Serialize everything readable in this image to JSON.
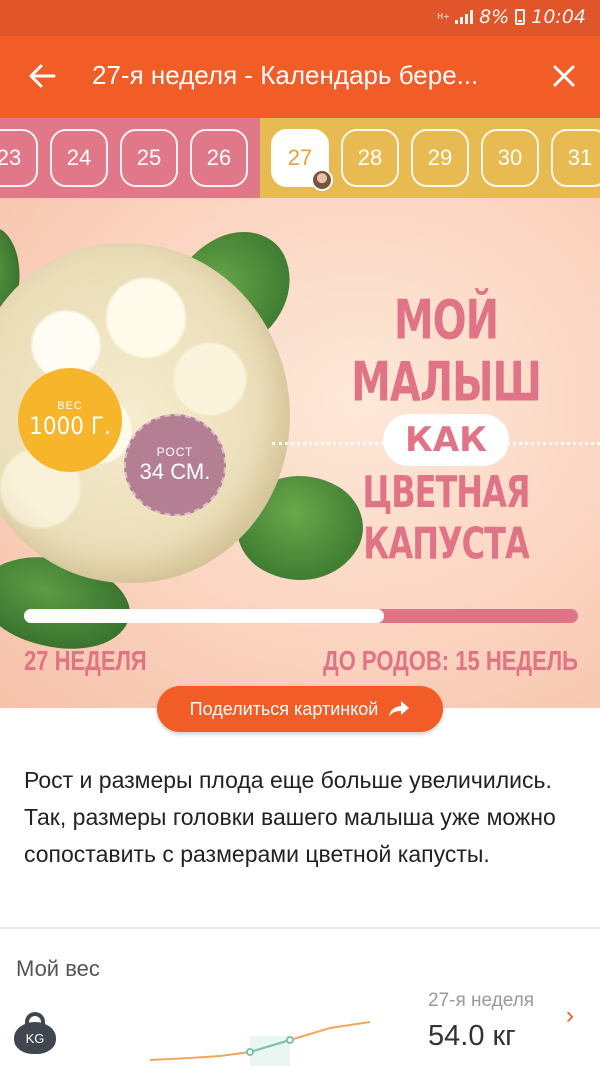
{
  "status_bar": {
    "network": "H+",
    "battery": "8%",
    "time": "10:04"
  },
  "app_bar": {
    "back_icon": "arrow-left-icon",
    "title": "27-я неделя - Календарь бере...",
    "close_icon": "close-icon"
  },
  "weeks": {
    "past": [
      "23",
      "24",
      "25",
      "26"
    ],
    "current": "27",
    "future": [
      "28",
      "29",
      "30",
      "31"
    ]
  },
  "hero": {
    "weight_label": "ВЕС",
    "weight_value": "1000 Г.",
    "height_label": "РОСТ",
    "height_value": "34 СМ.",
    "headline_1": "МОЙ МАЛЫШ",
    "headline_kak": "КАК",
    "headline_2": "ЦВЕТНАЯ КАПУСТА",
    "progress": 0.65,
    "week_footer": "27 НЕДЕЛЯ",
    "birth_footer": "ДО РОДОВ: 15 НЕДЕЛЬ"
  },
  "share_button": {
    "label": "Поделиться картинкой",
    "icon": "share-arrow-icon"
  },
  "description": "Рост и размеры плода еще больше увеличились. Так, размеры головки вашего малыша уже можно сопоставить с размерами цветной капусты.",
  "weight_section": {
    "title": "Мой вес",
    "icon_label": "KG",
    "week_caption": "27-я неделя",
    "value": "54.0 кг",
    "chevron_icon": "chevron-right-icon"
  },
  "colors": {
    "accent": "#f25c27",
    "pink": "#e07486",
    "yellow": "#e8ba52"
  }
}
